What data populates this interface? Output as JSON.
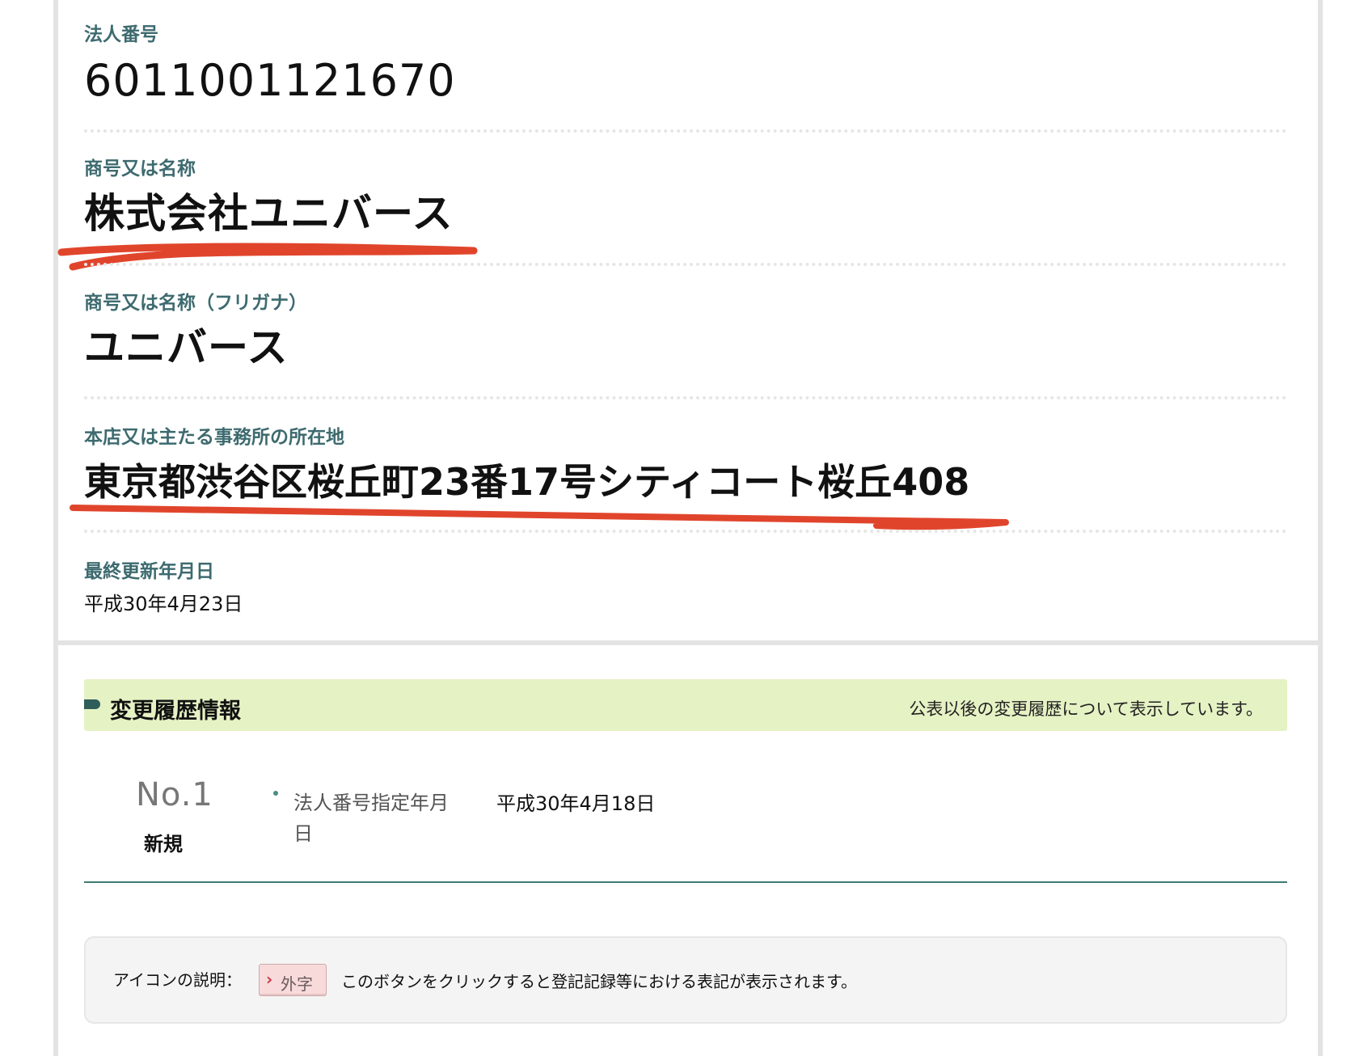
{
  "fields": [
    {
      "label": "法人番号",
      "value": "6011001121670"
    },
    {
      "label": "商号又は名称",
      "value": "株式会社ユニバース"
    },
    {
      "label": "商号又は名称（フリガナ）",
      "value": "ユニバース"
    },
    {
      "label": "本店又は主たる事務所の所在地",
      "value": "東京都渋谷区桜丘町23番17号シティコート桜丘408"
    },
    {
      "label": "最終更新年月日",
      "value": "平成30年4月23日"
    }
  ],
  "history": {
    "title": "変更履歴情報",
    "note": "公表以後の変更履歴について表示しています。",
    "entries": [
      {
        "number": "No.1",
        "type": "新規",
        "label": "法人番号指定年月日",
        "value": "平成30年4月18日"
      }
    ]
  },
  "legend": {
    "label": "アイコンの説明：",
    "button_arrow": "›",
    "button_label": "外字",
    "description": "このボタンをクリックすると登記記録等における表記が表示されます。"
  },
  "colors": {
    "label_teal": "#3d6a6f",
    "underline_red": "#e0452c",
    "history_header_bg": "#e5f2c4",
    "gaiji_button_bg": "#f8dada"
  },
  "icons": {
    "history_marker": "section-marker-icon",
    "gaiji_arrow": "chevron-right-icon"
  }
}
